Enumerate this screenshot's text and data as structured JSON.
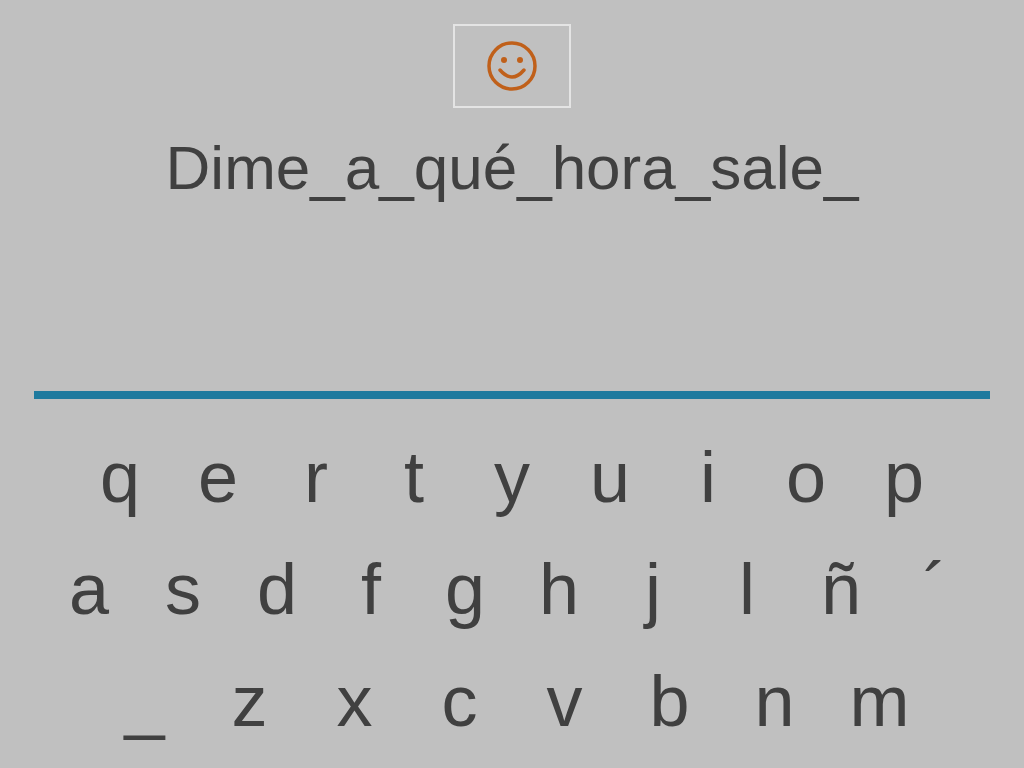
{
  "sentence": "Dime_a_qué_hora_sale_",
  "keyboard": {
    "rows": [
      [
        "q",
        "e",
        "r",
        "t",
        "y",
        "u",
        "i",
        "o",
        "p"
      ],
      [
        "a",
        "s",
        "d",
        "f",
        "g",
        "h",
        "j",
        "l",
        "ñ",
        "´"
      ],
      [
        "_",
        "z",
        "x",
        "c",
        "v",
        "b",
        "n",
        "m"
      ]
    ]
  }
}
